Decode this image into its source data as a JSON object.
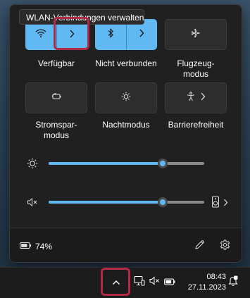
{
  "tooltip": "WLAN-Verbindungen verwalten",
  "tiles": [
    {
      "label": "Verfügbar",
      "icon": "wifi-icon",
      "active": true
    },
    {
      "label": "Nicht verbunden",
      "icon": "bluetooth-icon",
      "active": true
    },
    {
      "label": "Flugzeug-\nmodus",
      "icon": "airplane-icon",
      "active": false
    },
    {
      "label": "Stromspar-\nmodus",
      "icon": "battery-saver-icon",
      "active": false
    },
    {
      "label": "Nachtmodus",
      "icon": "night-light-icon",
      "active": false
    },
    {
      "label": "Barrierefreiheit",
      "icon": "accessibility-icon",
      "active": false
    }
  ],
  "sliders": {
    "brightness": {
      "icon": "brightness-icon",
      "value": 0.735
    },
    "volume": {
      "icon": "speaker-muted-icon",
      "value": 0.735
    }
  },
  "footer": {
    "battery_percent": "74%",
    "edit_icon": "pencil-icon",
    "settings_icon": "gear-icon"
  },
  "taskbar": {
    "time": "08:43",
    "date": "27.11.2023"
  },
  "colors": {
    "accent": "#60b9f2",
    "highlight": "#b22a46",
    "panel": "#202020"
  }
}
